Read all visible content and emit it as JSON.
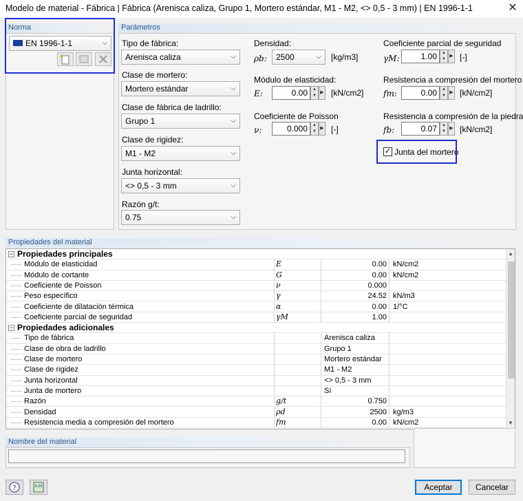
{
  "window": {
    "title": "Modelo de material - Fábrica | Fábrica (Arenisca caliza, Grupo 1, Mortero estándar, M1 - M2, <> 0,5 - 3 mm) | EN 1996-1-1"
  },
  "norma": {
    "header": "Norma",
    "selected": "EN 1996-1-1"
  },
  "parametros": {
    "header": "Parámetros",
    "tipo_fabrica": {
      "label": "Tipo de fábrica:",
      "value": "Arenisca caliza"
    },
    "clase_mortero": {
      "label": "Clase de mortero:",
      "value": "Mortero estándar"
    },
    "clase_ladrillo": {
      "label": "Clase de fábrica de ladrillo:",
      "value": "Grupo 1"
    },
    "clase_rigidez": {
      "label": "Clase de rigidez:",
      "value": "M1 - M2"
    },
    "junta_horizontal": {
      "label": "Junta horizontal:",
      "value": "<> 0,5 - 3 mm"
    },
    "razon": {
      "label": "Razón g/t:",
      "value": "0.75"
    },
    "densidad": {
      "label": "Densidad:",
      "symbol": "ρb:",
      "value": "2500",
      "unit": "[kg/m3]"
    },
    "modulo_elasticidad": {
      "label": "Módulo de elasticidad:",
      "symbol": "E:",
      "value": "0.00",
      "unit": "[kN/cm2]"
    },
    "poisson": {
      "label": "Coeficiente de Poisson",
      "symbol": "ν:",
      "value": "0.000",
      "unit": "[-]"
    },
    "coef_seguridad": {
      "label": "Coeficiente parcial de seguridad",
      "symbol": "γM:",
      "value": "1.00",
      "unit": "[-]"
    },
    "resist_mortero": {
      "label": "Resistencia a compresión del mortero",
      "symbol": "fm:",
      "value": "0.00",
      "unit": "[kN/cm2]"
    },
    "resist_piedra": {
      "label": "Resistencia a compresión de la piedra",
      "symbol": "fb:",
      "value": "0.07",
      "unit": "[kN/cm2]"
    },
    "junta_mortero": {
      "label": "Junta del mortero",
      "checked": true
    }
  },
  "propiedades": {
    "header": "Propiedades del material",
    "sections": [
      {
        "title": "Propiedades principales",
        "rows": [
          {
            "name": "Módulo de elasticidad",
            "symbol": "E",
            "value": "0.00",
            "unit": "kN/cm2"
          },
          {
            "name": "Módulo de cortante",
            "symbol": "G",
            "value": "0.00",
            "unit": "kN/cm2"
          },
          {
            "name": "Coeficiente de Poisson",
            "symbol": "ν",
            "value": "0.000",
            "unit": ""
          },
          {
            "name": "Peso específico",
            "symbol": "γ",
            "value": "24.52",
            "unit": "kN/m3"
          },
          {
            "name": "Coeficiente de dilatación térmica",
            "symbol": "α",
            "value": "0.00",
            "unit": "1/°C"
          },
          {
            "name": "Coeficiente parcial de seguridad",
            "symbol": "γM",
            "value": "1.00",
            "unit": ""
          }
        ]
      },
      {
        "title": "Propiedades adicionales",
        "rows": [
          {
            "name": "Tipo de fábrica",
            "symbol": "",
            "text": "Arenisca caliza"
          },
          {
            "name": "Clase de obra de ladrillo",
            "symbol": "",
            "text": "Grupo 1"
          },
          {
            "name": "Clase de mortero",
            "symbol": "",
            "text": "Mortero estándar"
          },
          {
            "name": "Clase de rigidez",
            "symbol": "",
            "text": "M1 - M2"
          },
          {
            "name": "Junta horizontal",
            "symbol": "",
            "text": "<> 0,5 - 3 mm"
          },
          {
            "name": "Junta de mortero",
            "symbol": "",
            "text": "Sí"
          },
          {
            "name": "Razón",
            "symbol": "g/t",
            "value": "0.750",
            "unit": ""
          },
          {
            "name": "Densidad",
            "symbol": "ρd",
            "value": "2500",
            "unit": "kg/m3"
          },
          {
            "name": "Resistencia media a compresión del mortero",
            "symbol": "fm",
            "value": "0.00",
            "unit": "kN/cm2"
          }
        ]
      }
    ]
  },
  "nombre": {
    "header": "Nombre del material",
    "value": ""
  },
  "buttons": {
    "aceptar": "Aceptar",
    "cancelar": "Cancelar"
  },
  "colors": {
    "highlight": "#1f2fd1",
    "group_header": "#2e5a8a",
    "default_button_border": "#0078d7"
  }
}
